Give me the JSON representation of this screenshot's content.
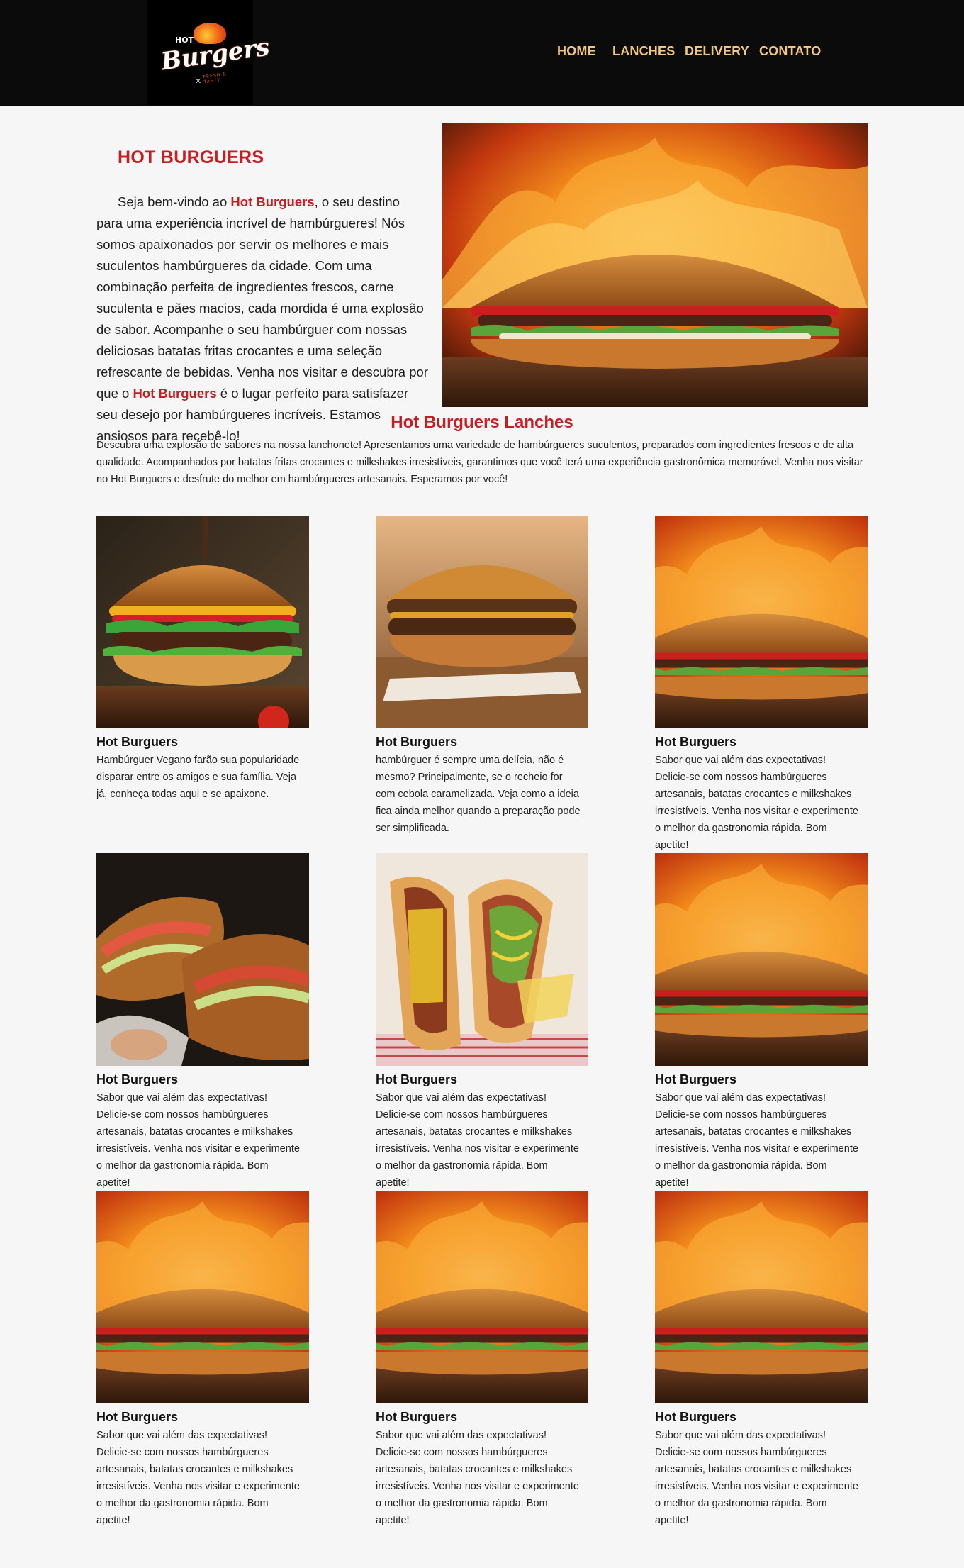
{
  "header": {
    "logo": {
      "hot": "HOT",
      "main": "Burgers",
      "tag": "FRESH & TASTY"
    },
    "nav": [
      "HOME",
      "LANCHES",
      "DELIVERY",
      "CONTATO"
    ]
  },
  "intro": {
    "title": "HOT BURGUERS",
    "p1": "Seja bem-vindo ao ",
    "brand1": "Hot Burguers",
    "p2": ", o seu destino para uma experiência incrível de hambúrgueres! Nós somos apaixonados por servir os melhores e mais suculentos hambúrgueres da cidade. Com uma combinação perfeita de ingredientes frescos, carne suculenta e pães macios, cada mordida é uma explosão de sabor. Acompanhe o seu hambúrguer com nossas deliciosas batatas fritas crocantes e uma seleção refrescante de bebidas. Venha nos visitar e descubra por que o ",
    "brand2": "Hot Burguers",
    "p3": " é o lugar perfeito para satisfazer seu desejo por hambúrgueres incríveis. Estamos ansiosos para recebê-lo!"
  },
  "lanches": {
    "title": "Hot Burguers Lanches",
    "text": "Descubra uma explosão de sabores na nossa lanchonete! Apresentamos uma variedade de hambúrgueres suculentos, preparados com ingredientes frescos e de alta qualidade. Acompanhados por batatas fritas crocantes e milkshakes irresistíveis, garantimos que você terá uma experiência gastronômica memorável. Venha nos visitar no Hot Burguers e desfrute do melhor em hambúrgueres artesanais. Esperamos por você!"
  },
  "cards": [
    {
      "title": "Hot Burguers",
      "desc": "Hambúrguer Vegano farão sua popularidade disparar entre os amigos e sua família. Veja já, conheça todas aqui e se apaixone.",
      "image": "cheeseburger-photo"
    },
    {
      "title": "Hot Burguers",
      "desc": "hambúrguer é sempre uma delícia, não é mesmo? Principalmente, se o recheio for com cebola caramelizada. Veja como a ideia fica ainda melhor quando a preparação pode ser simplificada.",
      "image": "classic-burger-photo"
    },
    {
      "title": "Hot Burguers",
      "desc": "Sabor que vai além das expectativas! Delicie-se com nossos hambúrgueres artesanais, batatas crocantes e milkshakes irresistíveis. Venha nos visitar e experimente o melhor da gastronomia rápida. Bom apetite!",
      "image": "fire-burger-photo"
    },
    {
      "title": "Hot Burguers",
      "desc": "Sabor que vai além das expectativas! Delicie-se com nossos hambúrgueres artesanais, batatas crocantes e milkshakes irresistíveis. Venha nos visitar e experimente o melhor da gastronomia rápida. Bom apetite!",
      "image": "wrapped-burgers-photo"
    },
    {
      "title": "Hot Burguers",
      "desc": "Sabor que vai além das expectativas! Delicie-se com nossos hambúrgueres artesanais, batatas crocantes e milkshakes irresistíveis. Venha nos visitar e experimente o melhor da gastronomia rápida. Bom apetite!",
      "image": "hotdogs-photo"
    },
    {
      "title": "Hot Burguers",
      "desc": "Sabor que vai além das expectativas! Delicie-se com nossos hambúrgueres artesanais, batatas crocantes e milkshakes irresistíveis. Venha nos visitar e experimente o melhor da gastronomia rápida. Bom apetite!",
      "image": "fire-burger-photo"
    },
    {
      "title": "Hot Burguers",
      "desc": "Sabor que vai além das expectativas! Delicie-se com nossos hambúrgueres artesanais, batatas crocantes e milkshakes irresistíveis. Venha nos visitar e experimente o melhor da gastronomia rápida. Bom apetite!",
      "image": "fire-burger-photo"
    },
    {
      "title": "Hot Burguers",
      "desc": "Sabor que vai além das expectativas! Delicie-se com nossos hambúrgueres artesanais, batatas crocantes e milkshakes irresistíveis. Venha nos visitar e experimente o melhor da gastronomia rápida. Bom apetite!",
      "image": "fire-burger-photo"
    },
    {
      "title": "Hot Burguers",
      "desc": "Sabor que vai além das expectativas! Delicie-se com nossos hambúrgueres artesanais, batatas crocantes e milkshakes irresistíveis. Venha nos visitar e experimente o melhor da gastronomia rápida. Bom apetite!",
      "image": "fire-burger-photo"
    }
  ],
  "colors": {
    "accent": "#c81d22",
    "nav": "#f2c67a",
    "header_bg": "#0b0b0b",
    "page_bg": "#f6f6f6"
  }
}
